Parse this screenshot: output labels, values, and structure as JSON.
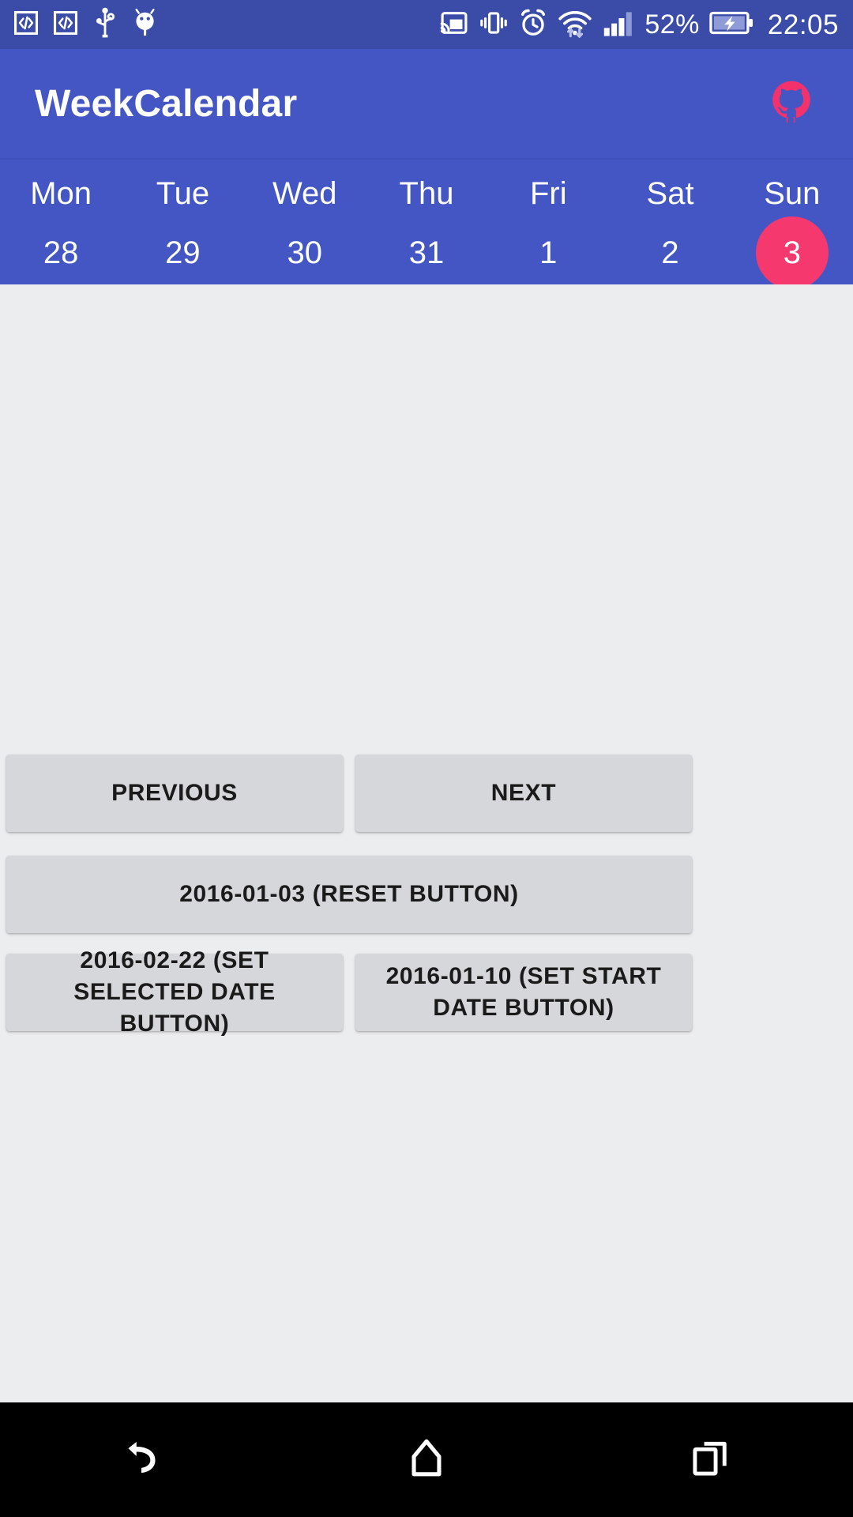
{
  "statusbar": {
    "left_icons": [
      "code-box-icon",
      "code-box-icon",
      "usb-icon",
      "android-head-icon"
    ],
    "right_icons": [
      "cast-icon",
      "vibrate-icon",
      "alarm-icon",
      "wifi-icon",
      "signal-bars-icon"
    ],
    "battery_percent": "52%",
    "battery_icon": "battery-charging-icon",
    "clock": "22:05",
    "bg_color": "#3A4BA8"
  },
  "appbar": {
    "title": "WeekCalendar",
    "action_icon": "github-octocat-icon",
    "action_color": "#F5316B",
    "bg_color": "#4356C4"
  },
  "week": {
    "bg_color": "#4356C4",
    "selected_color": "#F5396F",
    "days": [
      {
        "name": "Mon",
        "number": "28",
        "selected": false
      },
      {
        "name": "Tue",
        "number": "29",
        "selected": false
      },
      {
        "name": "Wed",
        "number": "30",
        "selected": false
      },
      {
        "name": "Thu",
        "number": "31",
        "selected": false
      },
      {
        "name": "Fri",
        "number": "1",
        "selected": false
      },
      {
        "name": "Sat",
        "number": "2",
        "selected": false
      },
      {
        "name": "Sun",
        "number": "3",
        "selected": true
      }
    ]
  },
  "content": {
    "bg_color": "#ECEDEF",
    "button_color": "#D6D7DA",
    "buttons": {
      "previous": "PREVIOUS",
      "next": "NEXT",
      "reset": "2016-01-03 (RESET BUTTON)",
      "set_selected_date": "2016-02-22 (SET SELECTED DATE BUTTON)",
      "set_start_date": "2016-01-10 (SET START DATE BUTTON)"
    }
  },
  "navbar": {
    "bg_color": "#000000",
    "items": [
      "back-icon",
      "home-icon",
      "recents-icon"
    ]
  }
}
